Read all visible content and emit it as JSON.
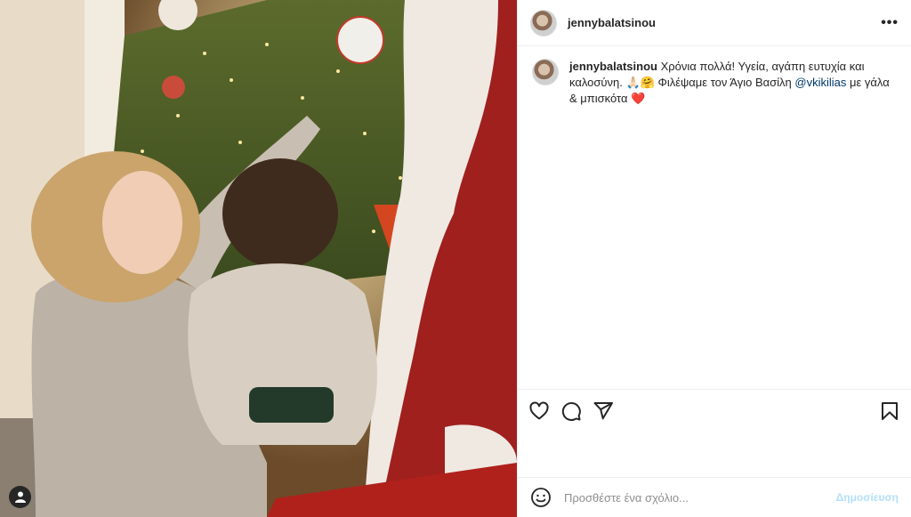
{
  "post": {
    "username": "jennybalatsinou",
    "more_label": "•••"
  },
  "caption": {
    "username": "jennybalatsinou",
    "text_before": "Χρόνια πολλά! Υγεία, αγάπη ευτυχία και καλοσύνη. 🙏🏻🤗 Φιλέψαμε τον Άγιο Βασίλη ",
    "mention": "@vkikilias",
    "text_after": " με γάλα & μπισκότα ",
    "heart": "❤️"
  },
  "icons": {
    "like": "heart-icon",
    "comment": "comment-icon",
    "share": "share-icon",
    "save": "bookmark-icon",
    "emoji": "emoji-icon",
    "user": "user-icon"
  },
  "comment_box": {
    "placeholder": "Προσθέστε ένα σχόλιο...",
    "post_label": "Δημοσίευση"
  },
  "colors": {
    "link": "#00376b",
    "post_button_disabled": "#b2dffc"
  }
}
